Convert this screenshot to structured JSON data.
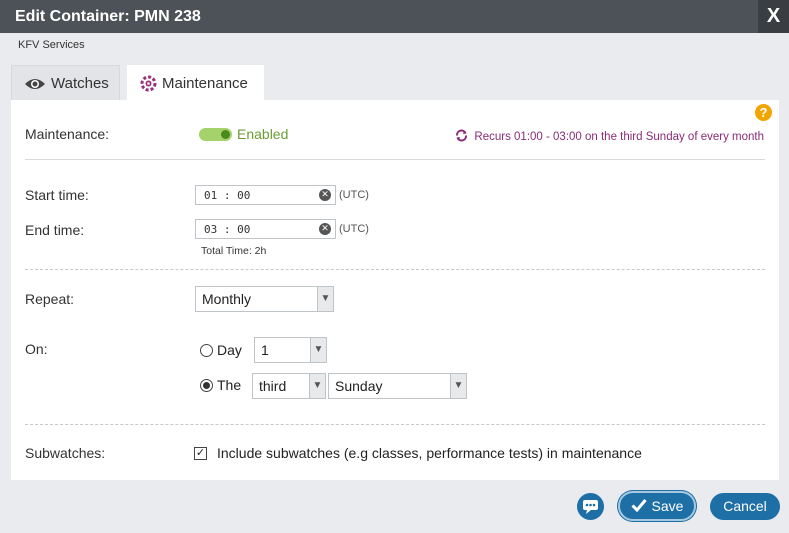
{
  "window": {
    "title": "Edit Container: PMN 238",
    "close_label": "X"
  },
  "subtitle": "KFV Services",
  "tabs": [
    {
      "label": "Watches",
      "icon": "eye-icon"
    },
    {
      "label": "Maintenance",
      "icon": "maintenance-gear-icon"
    }
  ],
  "maintenance": {
    "label": "Maintenance:",
    "status": "Enabled",
    "recurrence": "Recurs 01:00 - 03:00 on the third Sunday of every month",
    "help": "?"
  },
  "start_time": {
    "label": "Start time:",
    "value": "01 : 00",
    "tz": "(UTC)"
  },
  "end_time": {
    "label": "End time:",
    "value": "03 : 00",
    "tz": "(UTC)"
  },
  "total_time": "Total Time: 2h",
  "repeat": {
    "label": "Repeat:",
    "value": "Monthly"
  },
  "on": {
    "label": "On:",
    "day_label": "Day",
    "day_value": "1",
    "the_label": "The",
    "ordinal_value": "third",
    "weekday_value": "Sunday"
  },
  "subwatches": {
    "label": "Subwatches:",
    "checkbox_label": "Include subwatches (e.g classes, performance tests) in maintenance",
    "check_mark": "✓"
  },
  "buttons": {
    "save": "Save",
    "cancel": "Cancel"
  },
  "colors": {
    "accent": "#1d6fa5",
    "enabled_green": "#6a9e34",
    "recur_purple": "#8a2b77",
    "help_orange": "#f0a500"
  }
}
